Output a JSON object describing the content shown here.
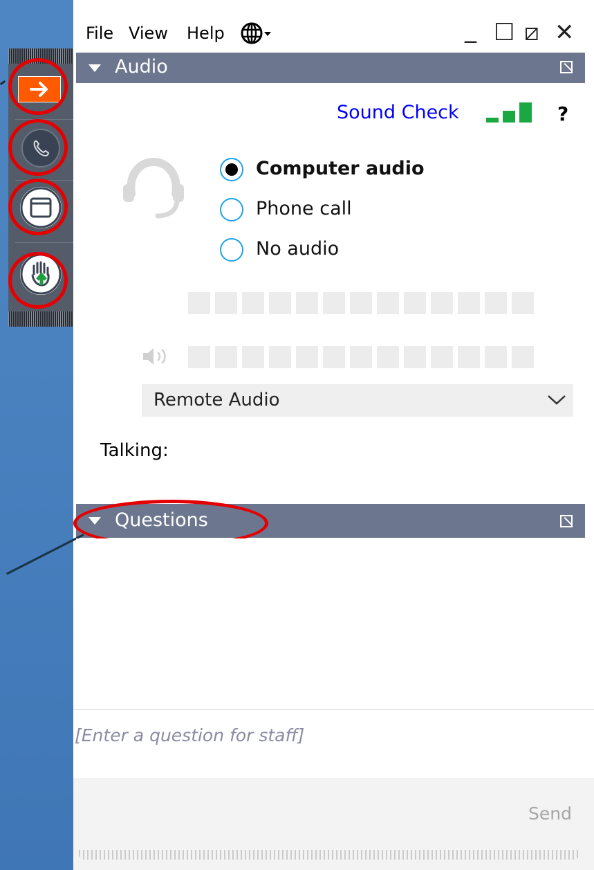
{
  "menu": {
    "file": "File",
    "view": "View",
    "help": "Help",
    "language_icon": "globe-icon"
  },
  "window_controls": {
    "minimize": "_",
    "maximize": "☐",
    "restore": "⧄",
    "close": "✕"
  },
  "side_toolbar": {
    "items": [
      {
        "name": "collapse-arrow",
        "icon": "arrow-right-icon"
      },
      {
        "name": "phone",
        "icon": "phone-icon"
      },
      {
        "name": "window",
        "icon": "window-icon"
      },
      {
        "name": "raise-hand",
        "icon": "hand-icon"
      }
    ],
    "accent_colors": {
      "arrow_tile": "#ff5a00",
      "hand_arrow": "#1e9e3c",
      "highlight_ring": "#e40000"
    }
  },
  "audio": {
    "title": "Audio",
    "sound_check": "Sound Check",
    "help": "?",
    "options": [
      {
        "label": "Computer audio",
        "selected": true
      },
      {
        "label": "Phone call",
        "selected": false
      },
      {
        "label": "No audio",
        "selected": false
      }
    ],
    "device": "Remote Audio",
    "talking_label": "Talking:"
  },
  "questions": {
    "title": "Questions",
    "input_placeholder": "[Enter a question for staff]",
    "send_label": "Send"
  },
  "colors": {
    "section_bar": "#6c768e",
    "link_blue": "#0000ff",
    "signal_green": "#19a841",
    "radio_border": "#1aa3e8",
    "background_blue": "#4a82c0"
  }
}
